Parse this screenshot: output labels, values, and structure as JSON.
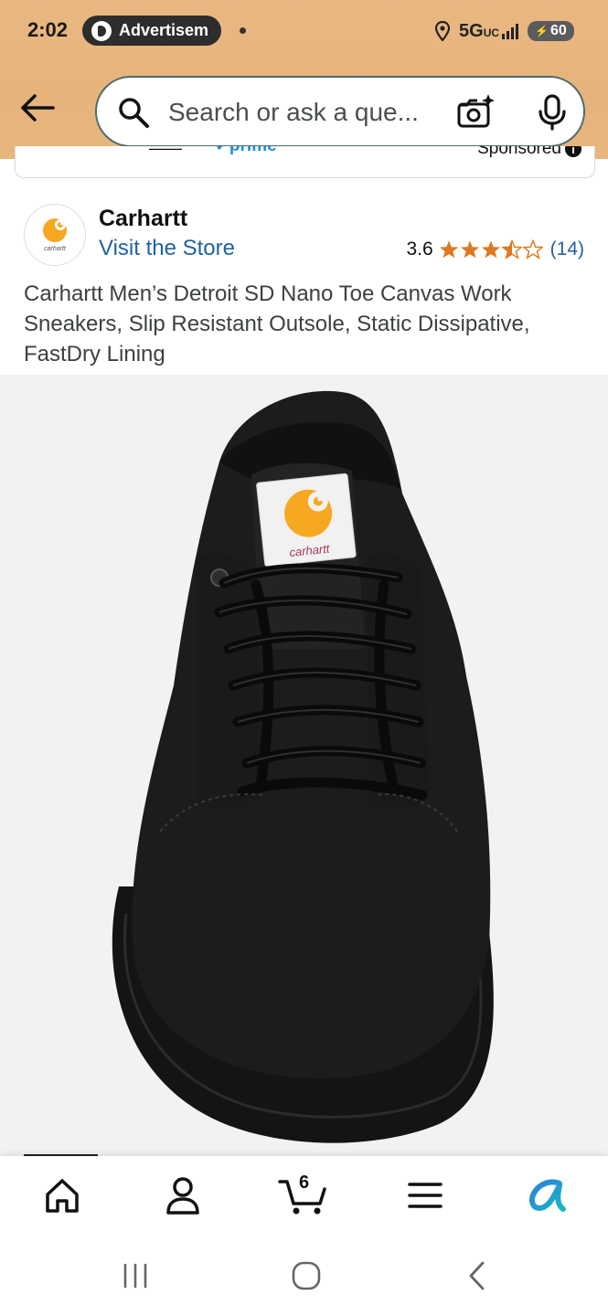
{
  "status_bar": {
    "time": "2:02",
    "notification": "Advertisem",
    "network": "5G",
    "network_sub": "UC",
    "battery": "60"
  },
  "search": {
    "placeholder": "Search or ask a que..."
  },
  "sponsored_strip": {
    "label": "Sponsored"
  },
  "brand": {
    "name": "Carhartt",
    "visit_store": "Visit the Store",
    "logo_text": "carhartt"
  },
  "rating": {
    "value": "3.6",
    "stars": 3.6,
    "count": "(14)"
  },
  "product": {
    "title": "Carhartt Men’s Detroit SD Nano Toe Canvas Work Sneakers, Slip Resistant Outsole, Static Dissipative, FastDry Lining",
    "image_tag_text": "carhartt"
  },
  "bottom_nav": {
    "cart_count": "6",
    "items": [
      "home-icon",
      "account-icon",
      "cart-icon",
      "menu-icon",
      "rufus-icon"
    ]
  },
  "colors": {
    "header_bg": "#e8b680",
    "link": "#2162a1",
    "star": "#de7921",
    "brand_yellow": "#f6a821"
  }
}
